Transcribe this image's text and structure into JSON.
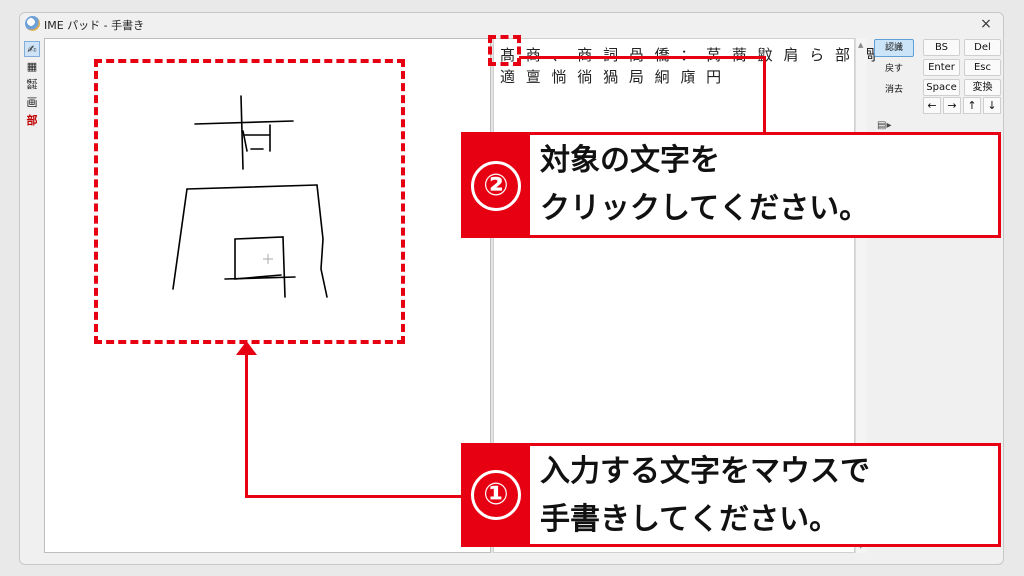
{
  "window": {
    "title": "IME パッド - 手書き",
    "close_symbol": "×"
  },
  "toolstrip": [
    "✍",
    "▦",
    "㍿",
    "画",
    "部"
  ],
  "candidates": {
    "row1": "髙 商 、 商 詞 咼 僑 ： 莴 蔏 鼤 肩 ら 部 渦",
    "row2": "適 亶 惝 徜 猧 局 絅 廎 円"
  },
  "commands": {
    "recognize": "認識",
    "back": "戻す",
    "clear": "消去"
  },
  "keys": [
    "BS",
    "Del",
    "Enter",
    "Esc",
    "Space",
    "変換"
  ],
  "arrows": [
    "←",
    "→",
    "↑",
    "↓"
  ],
  "callouts": {
    "one": {
      "number": "①",
      "line1": "入力する文字をマウスで",
      "line2": "手書きしてください。"
    },
    "two": {
      "number": "②",
      "line1": "対象の文字を",
      "line2": "クリックしてください。"
    }
  },
  "colors": {
    "accent": "#e60012"
  }
}
